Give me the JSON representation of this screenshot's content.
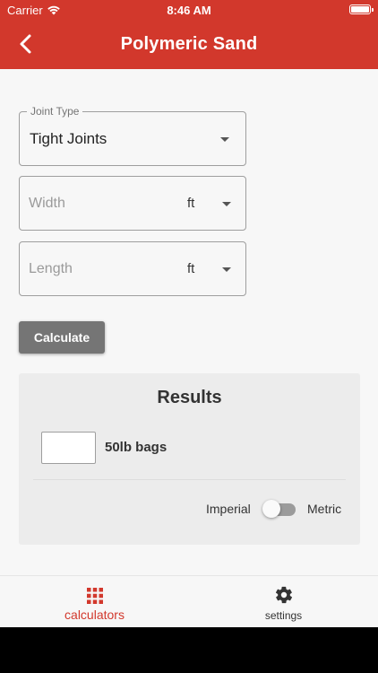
{
  "status_bar": {
    "carrier": "Carrier",
    "time": "8:46 AM"
  },
  "header": {
    "title": "Polymeric Sand"
  },
  "form": {
    "joint_type": {
      "label": "Joint Type",
      "value": "Tight Joints"
    },
    "width": {
      "placeholder": "Width",
      "unit": "ft"
    },
    "length": {
      "placeholder": "Length",
      "unit": "ft"
    },
    "calculate_label": "Calculate"
  },
  "results": {
    "title": "Results",
    "bags_label": "50lb bags",
    "unit_left": "Imperial",
    "unit_right": "Metric",
    "metric_enabled": false
  },
  "tabs": [
    {
      "label": "calculators",
      "icon": "grid-icon",
      "active": true
    },
    {
      "label": "settings",
      "icon": "gear-icon",
      "active": false
    }
  ],
  "colors": {
    "primary": "#d2382c",
    "button": "#757575",
    "results_bg": "#ececec"
  }
}
